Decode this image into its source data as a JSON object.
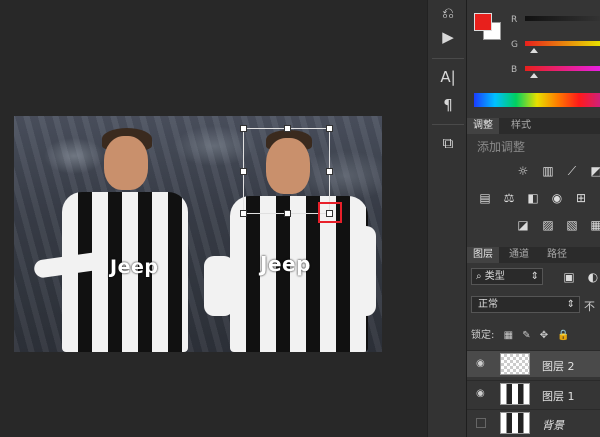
{
  "color": {
    "fg": "#e8201c",
    "bg": "#ffffff",
    "channels": [
      "R",
      "G",
      "B"
    ]
  },
  "adjust": {
    "tabs": [
      "调整",
      "样式"
    ],
    "title": "添加调整"
  },
  "layers": {
    "tabs": [
      "图层",
      "通道",
      "路径"
    ],
    "filter_label": "类型",
    "blend_mode": "正常",
    "opacity_label": "不",
    "lock_label": "锁定:",
    "items": [
      {
        "name": "图层 2",
        "selected": true,
        "visible": true
      },
      {
        "name": "图层 1",
        "selected": false,
        "visible": true
      },
      {
        "name": "背景",
        "selected": false,
        "visible": false
      }
    ]
  },
  "canvas": {
    "jersey_text": "Jeep"
  },
  "icons": [
    "move-history-icon",
    "play-icon",
    "character-icon",
    "paragraph-icon",
    "3d-icon"
  ]
}
